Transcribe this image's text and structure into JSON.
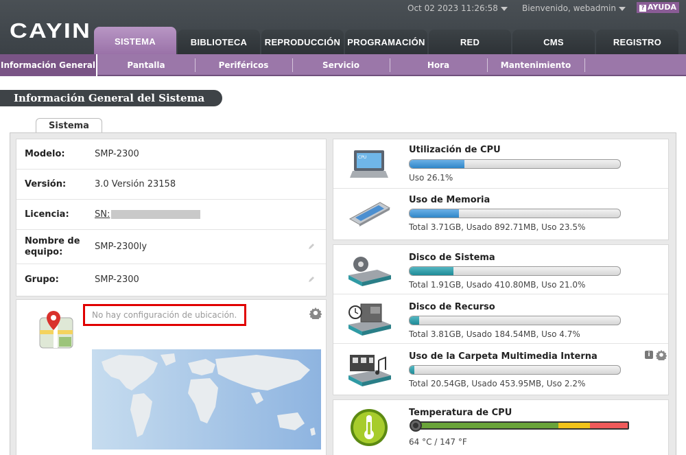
{
  "header": {
    "logo": "CAYIN",
    "datetime": "Oct 02 2023 11:26:58",
    "welcome": "Bienvenido, webadmin",
    "help_label": "AYUDA",
    "help_icon": "?"
  },
  "tabs": [
    {
      "label": "SISTEMA",
      "active": true
    },
    {
      "label": "BIBLIOTECA"
    },
    {
      "label": "REPRODUCCIÓN"
    },
    {
      "label": "PROGRAMACIÓN"
    },
    {
      "label": "RED"
    },
    {
      "label": "CMS"
    },
    {
      "label": "REGISTRO"
    }
  ],
  "subnav": [
    {
      "label": "Información General",
      "active": true
    },
    {
      "label": "Pantalla"
    },
    {
      "label": "Periféricos"
    },
    {
      "label": "Servicio"
    },
    {
      "label": "Hora"
    },
    {
      "label": "Mantenimiento"
    }
  ],
  "page_title": "Información General del Sistema",
  "section_tab": "Sistema",
  "info": {
    "model_label": "Modelo:",
    "model_value": "SMP-2300",
    "version_label": "Versión:",
    "version_value": "3.0 Versión 23158",
    "license_label": "Licencia:",
    "license_value": "SN:",
    "name_label": "Nombre de equipo:",
    "name_value": "SMP-2300ly",
    "group_label": "Grupo:",
    "group_value": "SMP-2300"
  },
  "location": {
    "message": "No hay configuración de ubicación."
  },
  "stats": {
    "cpu": {
      "label": "Utilización de CPU",
      "text": "Uso 26.1%",
      "percent": 26.1
    },
    "memory": {
      "label": "Uso de Memoria",
      "text": "Total 3.71GB, Usado 892.71MB, Uso 23.5%",
      "percent": 23.5
    },
    "system_disk": {
      "label": "Disco de Sistema",
      "text": "Total 1.91GB, Usado 410.80MB, Uso 21.0%",
      "percent": 21.0
    },
    "resource_disk": {
      "label": "Disco de Recurso",
      "text": "Total 3.81GB, Usado 184.54MB, Uso 4.7%",
      "percent": 4.7
    },
    "media_folder": {
      "label": "Uso de la Carpeta Multimedia Interna",
      "text": "Total 20.54GB, Usado 453.95MB, Uso 2.2%",
      "percent": 2.2
    },
    "cpu_temp": {
      "label": "Temperatura de CPU",
      "text": "64 °C / 147 °F"
    }
  },
  "colors": {
    "accent_purple": "#9b77a9",
    "bar_blue": "#2f86c8",
    "bar_teal": "#1e8a96",
    "highlight_red": "#e00000"
  }
}
